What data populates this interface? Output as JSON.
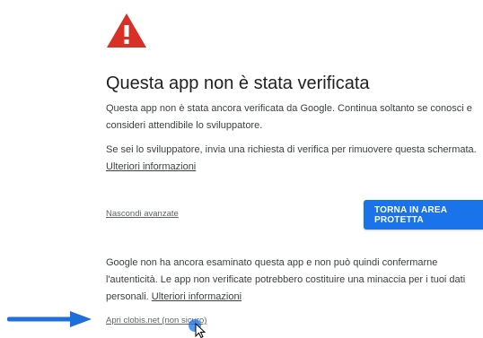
{
  "page": {
    "title": "Questa app non è stata verificata",
    "intro_text": "Questa app non è stata ancora verificata da Google. Continua soltanto se conosci e consideri attendibile lo sviluppatore.",
    "developer_text": "Se sei lo sviluppatore, invia una richiesta di verifica per rimuovere questa schermata.",
    "more_info_link_1": "Ulteriori informazioni",
    "advanced_toggle": "Nascondi avanzate",
    "back_button": "TORNA IN AREA PROTETTA",
    "details_text": "Google non ha ancora esaminato questa app e non può quindi confermarne l'autenticità. Le app non verificate potrebbero costituire una minaccia per i tuoi dati personali.",
    "more_info_link_2": "Ulteriori informazioni",
    "proceed_link": "Apri clobis.net (non sicuro)"
  },
  "icons": {
    "warning": "warning-triangle-icon",
    "arrow": "arrow-right-icon",
    "cursor": "mouse-cursor-icon"
  },
  "colors": {
    "warning_red": "#d93025",
    "button_blue": "#1a73e8",
    "arrow_blue": "#1e6fd9"
  }
}
